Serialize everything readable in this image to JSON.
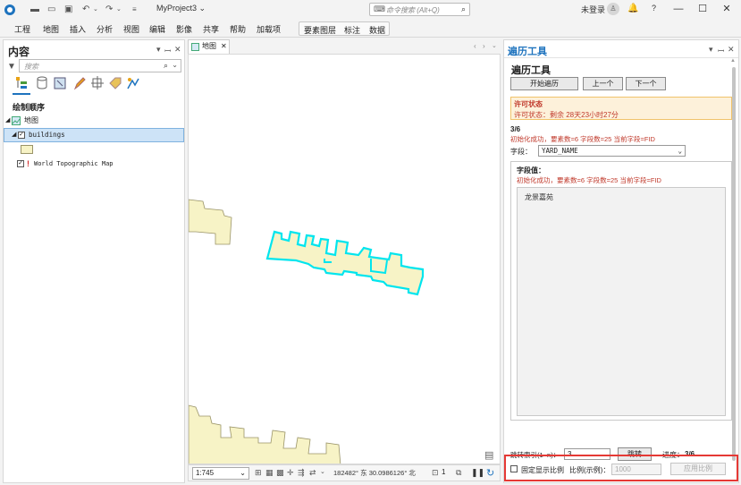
{
  "titlebar": {
    "project": "MyProject3",
    "project_caret": "⌄",
    "search_placeholder": "命令搜索 (Alt+Q)",
    "user": "未登录",
    "help": "?"
  },
  "ribbon": {
    "tabs": [
      "工程",
      "地图",
      "插入",
      "分析",
      "视图",
      "编辑",
      "影像",
      "共享",
      "帮助",
      "加载项"
    ],
    "context_tabs": [
      "要素图层",
      "标注",
      "数据"
    ]
  },
  "contents": {
    "title": "内容",
    "search_placeholder": "搜索",
    "drawing_order_label": "绘制顺序",
    "map_node": "地图",
    "layer_buildings": "buildings",
    "layer_basemap": "World Topographic Map"
  },
  "map_view": {
    "tab_label": "地图",
    "scale": "1:745",
    "coords": "182482° 东 30.0986126° 北",
    "selected_count": "1"
  },
  "traverse_pane": {
    "pane_title": "遍历工具",
    "heading": "遍历工具",
    "buttons": {
      "start": "开始遍历",
      "prev": "上一个",
      "next": "下一个"
    },
    "license": {
      "title": "许可状态",
      "status": "许可状态：剩余 28天23小时27分"
    },
    "progress": "3/6",
    "init_message": "初始化成功，要素数=6 字段数=25 当前字段=FID",
    "field_label": "字段：",
    "field_value": "YARD_NAME",
    "field_box_title": "字段值：",
    "field_box_message": "初始化成功，要素数=6 字段数=25 当前字段=FID",
    "value_text": "龙景嘉苑",
    "jump_label": "跳转索引(1~n)：",
    "jump_value": "3",
    "jump_button": "跳转",
    "progress_label": "进度：",
    "progress_value": "3/6",
    "fixed_scale_label": "固定显示比例",
    "scale_label": "比例(示例)：",
    "scale_placeholder": "1000",
    "apply_button": "应用比例"
  },
  "colors": {
    "accent": "#1e73be",
    "building_fill": "#f7f3c6",
    "building_stroke": "#9a9468",
    "selection": "#00e5ee",
    "license_bg": "#fdf1da",
    "error_red": "#c0392b",
    "highlight_red": "#e53935"
  }
}
